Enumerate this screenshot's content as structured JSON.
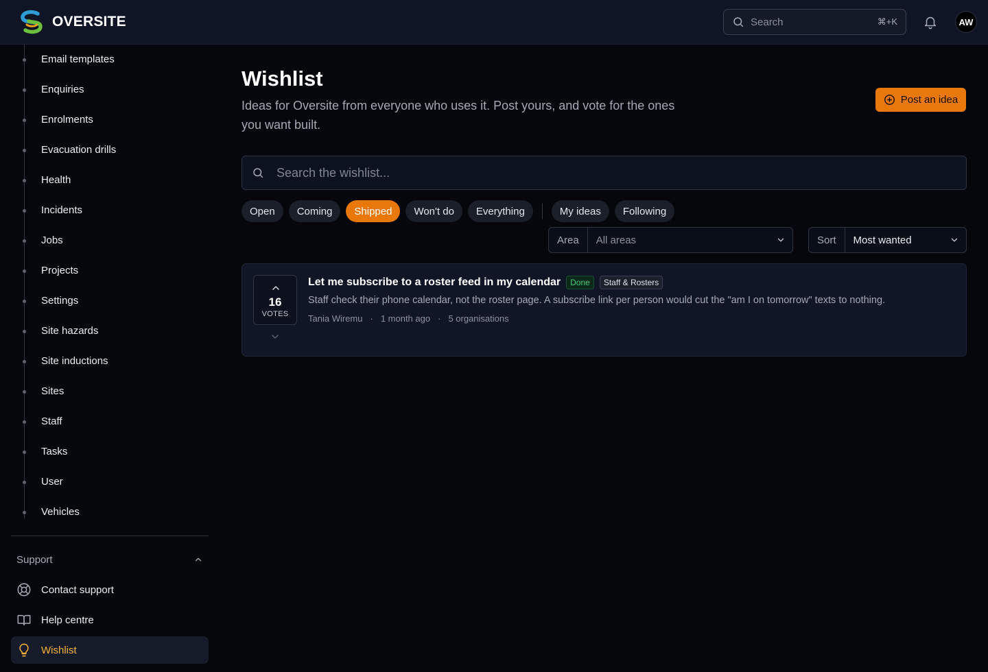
{
  "app": {
    "brand": "OVERSITE",
    "search_placeholder": "Search",
    "search_shortcut": "⌘+K",
    "avatar_initials": "AW",
    "accent": "#e8780a"
  },
  "sidebar": {
    "items": [
      {
        "label": "Email templates"
      },
      {
        "label": "Enquiries"
      },
      {
        "label": "Enrolments"
      },
      {
        "label": "Evacuation drills"
      },
      {
        "label": "Health"
      },
      {
        "label": "Incidents"
      },
      {
        "label": "Jobs"
      },
      {
        "label": "Projects"
      },
      {
        "label": "Settings"
      },
      {
        "label": "Site hazards"
      },
      {
        "label": "Site inductions"
      },
      {
        "label": "Sites"
      },
      {
        "label": "Staff"
      },
      {
        "label": "Tasks"
      },
      {
        "label": "User"
      },
      {
        "label": "Vehicles"
      }
    ],
    "support": {
      "heading": "Support",
      "items": [
        {
          "label": "Contact support",
          "icon": "lifebuoy-icon"
        },
        {
          "label": "Help centre",
          "icon": "book-icon"
        },
        {
          "label": "Wishlist",
          "icon": "lightbulb-icon",
          "active": true
        }
      ]
    }
  },
  "main": {
    "title": "Wishlist",
    "subtitle": "Ideas for Oversite from everyone who uses it. Post yours, and vote for the ones you want built.",
    "post_button": "Post an idea",
    "search_placeholder": "Search the wishlist...",
    "filters": [
      "Open",
      "Coming",
      "Shipped",
      "Won't do",
      "Everything"
    ],
    "filters_personal": [
      "My ideas",
      "Following"
    ],
    "active_filter": "Shipped",
    "area": {
      "label": "Area",
      "value": "All areas"
    },
    "sort": {
      "label": "Sort",
      "value": "Most wanted"
    }
  },
  "ideas": [
    {
      "votes": "16",
      "votes_label": "VOTES",
      "title": "Let me subscribe to a roster feed in my calendar",
      "status": "Done",
      "area": "Staff & Rosters",
      "description": "Staff check their phone calendar, not the roster page. A subscribe link per person would cut the \"am I on tomorrow\" texts to nothing.",
      "author": "Tania Wiremu",
      "age": "1 month ago",
      "orgs": "5 organisations"
    }
  ]
}
